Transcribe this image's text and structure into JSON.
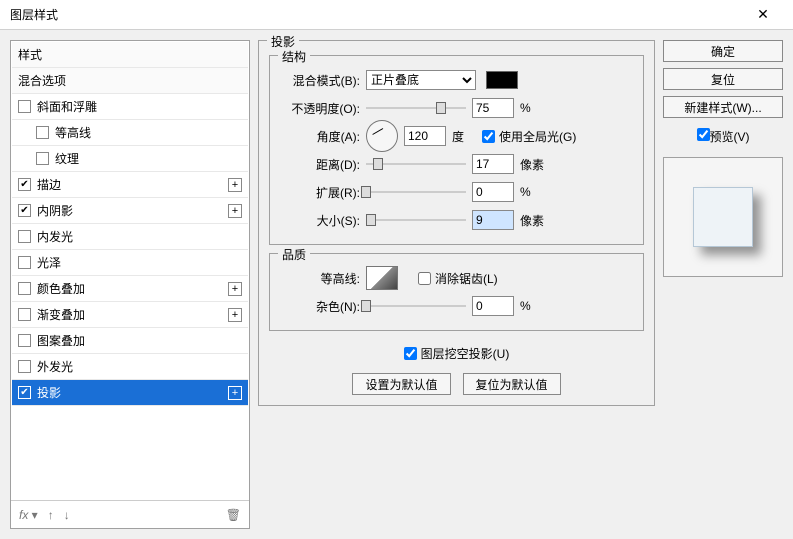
{
  "title": "图层样式",
  "styles": {
    "header1": "样式",
    "header2": "混合选项",
    "bevel": "斜面和浮雕",
    "contour": "等高线",
    "texture": "纹理",
    "stroke": "描边",
    "innerShadow": "内阴影",
    "innerGlow": "内发光",
    "satin": "光泽",
    "colorOverlay": "颜色叠加",
    "gradientOverlay": "渐变叠加",
    "patternOverlay": "图案叠加",
    "outerGlow": "外发光",
    "dropShadow": "投影"
  },
  "panel": {
    "title": "投影",
    "structure": "结构",
    "blendMode": "混合模式(B):",
    "blendValue": "正片叠底",
    "opacity": "不透明度(O):",
    "opacityVal": "75",
    "percent": "%",
    "angle": "角度(A):",
    "angleVal": "120",
    "degree": "度",
    "globalLight": "使用全局光(G)",
    "distance": "距离(D):",
    "distanceVal": "17",
    "px": "像素",
    "spread": "扩展(R):",
    "spreadVal": "0",
    "size": "大小(S):",
    "sizeVal": "9",
    "quality": "品质",
    "contourLbl": "等高线:",
    "antialias": "消除锯齿(L)",
    "noise": "杂色(N):",
    "noiseVal": "0",
    "knockout": "图层挖空投影(U)",
    "setDefault": "设置为默认值",
    "resetDefault": "复位为默认值"
  },
  "buttons": {
    "ok": "确定",
    "cancel": "复位",
    "newStyle": "新建样式(W)...",
    "preview": "预览(V)"
  },
  "footer": {
    "fx": "fx"
  }
}
